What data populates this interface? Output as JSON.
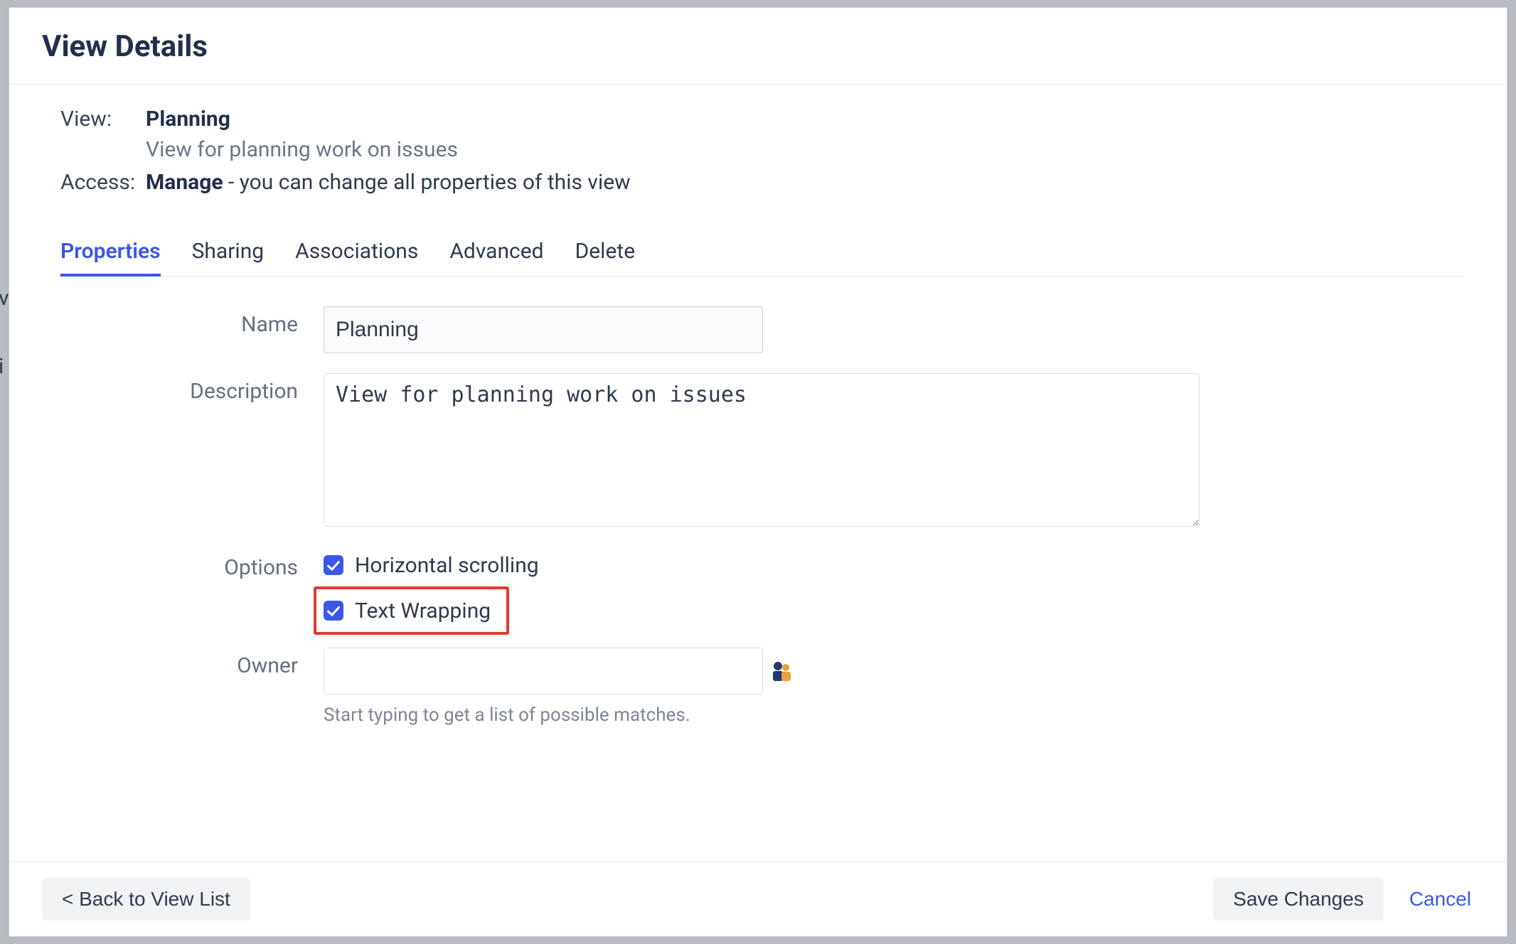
{
  "modal": {
    "title": "View Details"
  },
  "meta": {
    "view_label": "View:",
    "view_name": "Planning",
    "view_description": "View for planning work on issues",
    "access_label": "Access:",
    "access_value": "Manage",
    "access_suffix": " - you can change all properties of this view"
  },
  "tabs": [
    {
      "label": "Properties",
      "active": true
    },
    {
      "label": "Sharing",
      "active": false
    },
    {
      "label": "Associations",
      "active": false
    },
    {
      "label": "Advanced",
      "active": false
    },
    {
      "label": "Delete",
      "active": false
    }
  ],
  "form": {
    "name_label": "Name",
    "name_value": "Planning",
    "description_label": "Description",
    "description_value": "View for planning work on issues",
    "options_label": "Options",
    "option_hscroll": "Horizontal scrolling",
    "option_textwrap": "Text Wrapping",
    "owner_label": "Owner",
    "owner_value": "",
    "owner_hint": "Start typing to get a list of possible matches."
  },
  "footer": {
    "back": "< Back to View List",
    "save": "Save Changes",
    "cancel": "Cancel"
  },
  "bg_peek": "v\n \ni"
}
